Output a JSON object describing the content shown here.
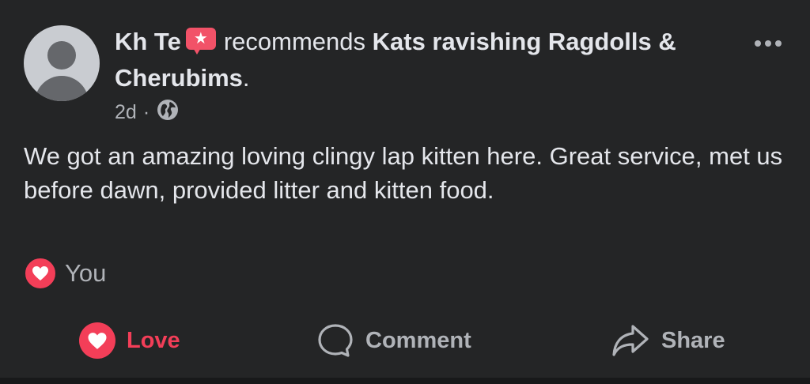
{
  "post": {
    "author": "Kh Te",
    "action_text": "recommends",
    "page_name": "Kats ravishing Ragdolls & Cherubims",
    "period": ".",
    "time": "2d",
    "separator": "·",
    "audience_icon": "globe-icon",
    "body": "We got an amazing loving clingy lap kitten here. Great service, met us before dawn, provided litter and kitten food."
  },
  "reactions": {
    "icon": "heart-icon",
    "label": "You"
  },
  "actions": {
    "love_label": "Love",
    "comment_label": "Comment",
    "share_label": "Share"
  },
  "icons": {
    "recommend_badge": "recommend-star-icon",
    "more": "more-icon"
  },
  "colors": {
    "background": "#242526",
    "text_primary": "#e4e6eb",
    "text_secondary": "#b0b3b8",
    "love": "#f33e58",
    "badge": "#f25268"
  }
}
